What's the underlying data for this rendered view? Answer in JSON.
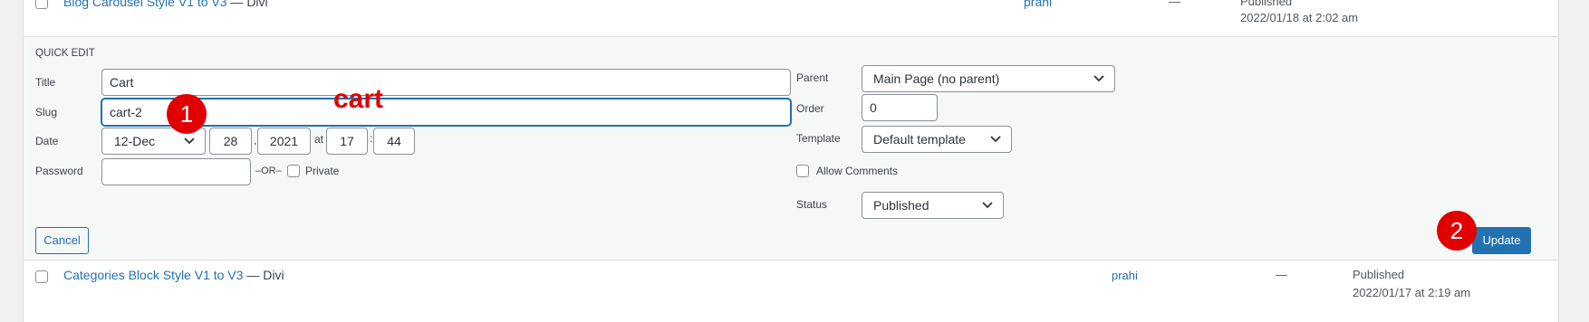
{
  "prev_row": {
    "title": "Blog Carousel Style V1 to V3",
    "suffix": " — Divi",
    "author": "prahi",
    "dash": "—",
    "status": "Published",
    "date": "2022/01/18 at 2:02 am"
  },
  "quick_edit": {
    "heading": "QUICK EDIT",
    "title_label": "Title",
    "title_value": "Cart",
    "slug_label": "Slug",
    "slug_value": "cart-2",
    "date_label": "Date",
    "month": "12-Dec",
    "day": "28",
    "year": "2021",
    "at": "at",
    "hour": "17",
    "colon": ":",
    "minute": "44",
    "comma": ",",
    "password_label": "Password",
    "password_value": "",
    "or_label": "–OR–",
    "private_label": "Private",
    "parent_label": "Parent",
    "parent_value": "Main Page (no parent)",
    "order_label": "Order",
    "order_value": "0",
    "template_label": "Template",
    "template_value": "Default template",
    "allow_comments_label": "Allow Comments",
    "status_label": "Status",
    "status_value": "Published",
    "cancel_label": "Cancel",
    "update_label": "Update"
  },
  "next_row": {
    "title": "Categories Block Style V1 to V3",
    "suffix": " — Divi",
    "author": "prahi",
    "dash": "—",
    "status": "Published",
    "date": "2022/01/17 at 2:19 am"
  },
  "annotations": {
    "marker1": "1",
    "marker2": "2",
    "note": "cart",
    "color": "#e00000"
  },
  "colors": {
    "link": "#2271b1",
    "primary": "#2271b1",
    "quick_edit_bg": "#f6f7f7"
  }
}
